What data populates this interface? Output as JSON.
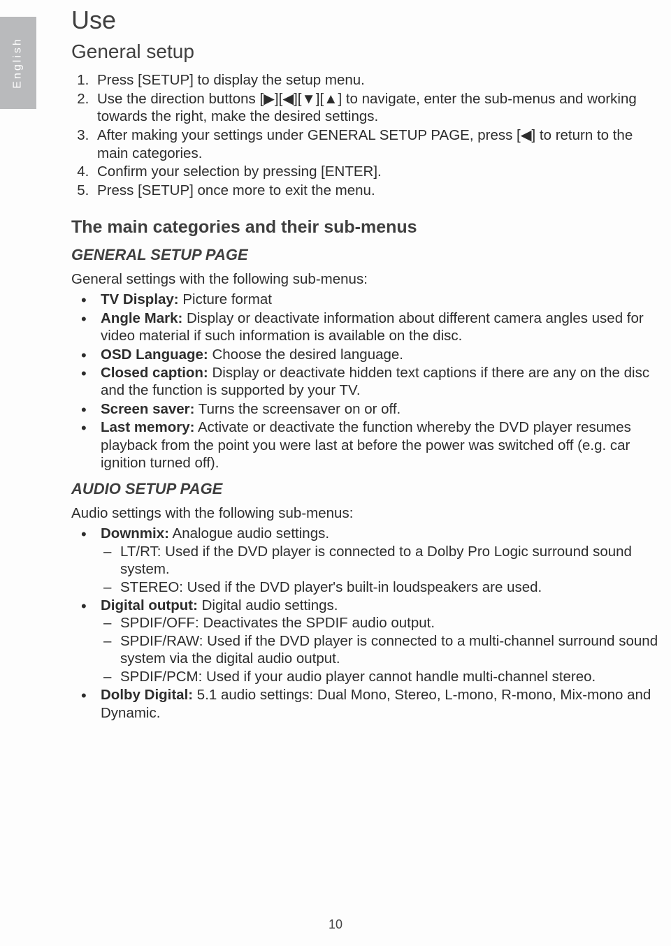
{
  "lang_tab": "English",
  "title": "Use",
  "general_setup_heading": "General setup",
  "steps": [
    "Press [SETUP] to display the setup menu.",
    "Use the direction buttons [▶][◀][▼][▲] to navigate, enter the sub-menus and working towards the right, make the desired settings.",
    "After making your settings under GENERAL SETUP PAGE, press [◀] to return to the main categories.",
    "Confirm your selection by pressing [ENTER].",
    "Press [SETUP] once more to exit the menu."
  ],
  "main_cat_heading": "The main categories and their sub-menus",
  "gsp_heading": "GENERAL SETUP PAGE",
  "gsp_intro": "General settings with the following sub-menus:",
  "gsp_items": [
    {
      "label": "TV Display:",
      "text": " Picture format"
    },
    {
      "label": "Angle Mark:",
      "text": " Display or deactivate information about different camera angles used for video material if such information is available on the disc."
    },
    {
      "label": "OSD Language:",
      "text": " Choose the desired language."
    },
    {
      "label": "Closed caption:",
      "text": " Display or deactivate hidden text captions if there are any on the disc and the function is supported by your TV."
    },
    {
      "label": "Screen saver:",
      "text": " Turns the screensaver on or off."
    },
    {
      "label": "Last memory:",
      "text": " Activate or deactivate the function whereby the DVD player resumes playback from the point you were last at before the power was switched off (e.g. car ignition turned off)."
    }
  ],
  "asp_heading": "AUDIO SETUP PAGE",
  "asp_intro": "Audio settings with the following sub-menus:",
  "asp_items": [
    {
      "label": "Downmix:",
      "text": " Analogue audio settings.",
      "subs": [
        "LT/RT: Used if the DVD player is connected to a Dolby Pro Logic surround sound system.",
        "STEREO: Used if the DVD player's built-in loudspeakers are used."
      ]
    },
    {
      "label": "Digital output:",
      "text": " Digital audio settings.",
      "subs": [
        "SPDIF/OFF: Deactivates the SPDIF audio output.",
        "SPDIF/RAW: Used if the DVD player is connected to a multi-channel surround sound system via the digital audio output.",
        "SPDIF/PCM: Used if your audio player cannot handle multi-channel stereo."
      ]
    },
    {
      "label": "Dolby Digital:",
      "text": " 5.1 audio settings: Dual Mono, Stereo, L-mono, R-mono, Mix-mono and Dynamic."
    }
  ],
  "page_number": "10"
}
